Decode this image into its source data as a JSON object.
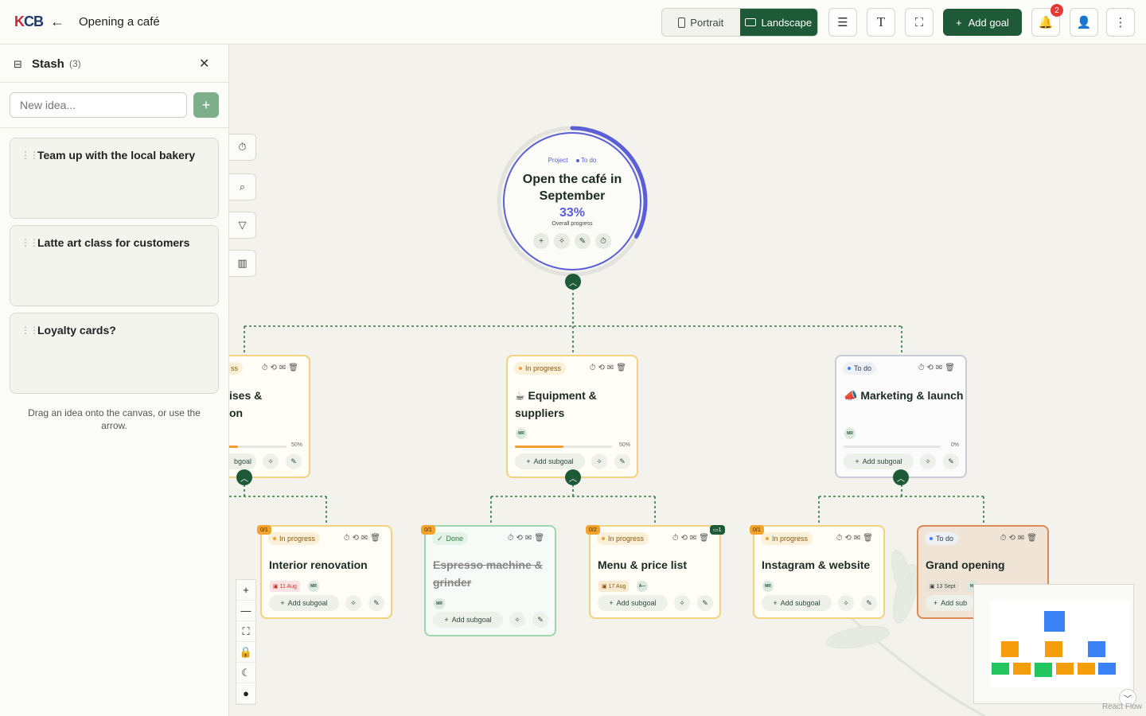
{
  "header": {
    "title": "Opening a café",
    "view_portrait": "Portrait",
    "view_landscape": "Landscape",
    "add_goal": "Add goal",
    "notifications_count": "2"
  },
  "stash": {
    "title": "Stash",
    "count": "(3)",
    "input_placeholder": "New idea...",
    "ideas": [
      "Team up with the local bakery",
      "Latte art class for customers",
      "Loyalty cards?"
    ],
    "hint": "Drag an idea onto the canvas, or use the arrow."
  },
  "root": {
    "type_label": "Project",
    "status": "To do",
    "title": "Open the café in September",
    "progress": "33%",
    "progress_value": 33,
    "progress_label": "Overall progress"
  },
  "goals": {
    "premises": {
      "status": "ss",
      "title_line1": "ises &",
      "title_line2": "on",
      "progress_label": "50%",
      "progress_value": 50,
      "add": "bgoal"
    },
    "equipment": {
      "status": "In progress",
      "title": "☕ Equipment & suppliers",
      "avatar": "MR",
      "progress_label": "50%",
      "progress_value": 50,
      "add": "Add subgoal"
    },
    "marketing": {
      "status": "To do",
      "title": "📣 Marketing & launch",
      "avatar": "MR",
      "progress_label": "0%",
      "progress_value": 0,
      "add": "Add subgoal"
    },
    "interior": {
      "badge": "0/1",
      "status": "In progress",
      "title": "Interior renovation",
      "date": "11 Aug",
      "avatar": "MR",
      "add": "Add subgoal"
    },
    "espresso": {
      "badge": "0/1",
      "status": "Done",
      "title": "Espresso machine & grinder",
      "avatar": "MR",
      "add": "Add subgoal"
    },
    "menu": {
      "badge": "0/2",
      "status": "In progress",
      "title": "Menu & price list",
      "date": "17 Aug",
      "avatar": "A—",
      "comments": "1",
      "add": "Add subgoal"
    },
    "instagram": {
      "badge": "0/1",
      "status": "In progress",
      "title": "Instagram & website",
      "avatar": "MR",
      "add": "Add subgoal"
    },
    "opening": {
      "status": "To do",
      "title": "Grand opening",
      "date": "13 Sept",
      "avatar": "M",
      "add": "Add sub"
    }
  },
  "footer": {
    "attribution": "React Flow"
  },
  "colors": {
    "primary": "#1e5a38",
    "accent": "#5b5fd6",
    "in_progress": "#f0a030",
    "done": "#2f9a55",
    "todo": "#3b82f6"
  },
  "icons": [
    "logo",
    "back-arrow-icon",
    "portrait-icon",
    "landscape-icon",
    "layout-icon",
    "text-icon",
    "fullscreen-icon",
    "plus-icon",
    "bell-icon",
    "user-icon",
    "more-icon",
    "inbox-icon",
    "close-icon",
    "timer-icon",
    "search-icon",
    "filter-icon",
    "chart-icon",
    "zoom-in-icon",
    "zoom-out-icon",
    "fit-icon",
    "lock-icon",
    "moon-icon",
    "palette-icon"
  ]
}
